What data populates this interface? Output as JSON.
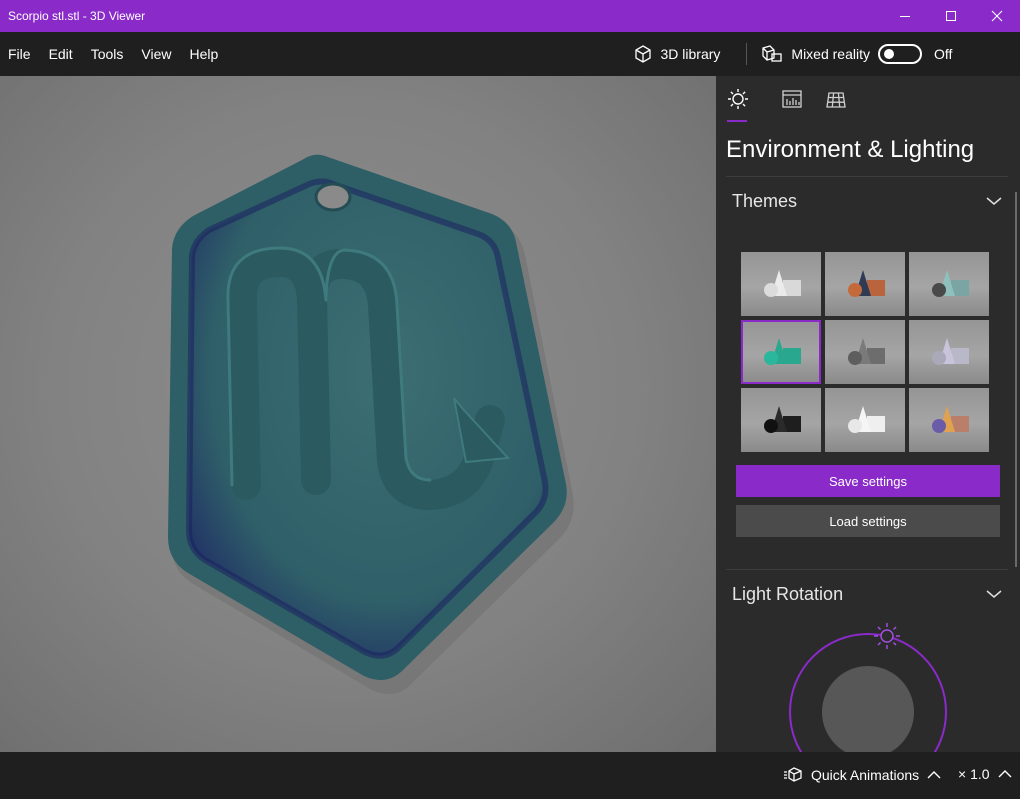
{
  "window": {
    "title": "Scorpio stl.stl - 3D Viewer",
    "accent": "#8a2bc9"
  },
  "menu": {
    "items": [
      {
        "label": "File"
      },
      {
        "label": "Edit"
      },
      {
        "label": "Tools"
      },
      {
        "label": "View"
      },
      {
        "label": "Help"
      }
    ]
  },
  "toolbar": {
    "library_label": "3D library",
    "library_icon": "cube-icon",
    "mixed_reality_label": "Mixed reality",
    "mixed_reality_icon": "mixed-reality-icon",
    "mixed_reality_state": "Off"
  },
  "viewport": {
    "model_color": "#2d5d66",
    "background": "#838383"
  },
  "panel": {
    "tabs": [
      {
        "icon": "environment-lighting-icon",
        "active": true
      },
      {
        "icon": "stats-shading-icon",
        "active": false
      },
      {
        "icon": "grid-icon",
        "active": false
      }
    ],
    "title": "Environment & Lighting",
    "themes": {
      "heading": "Themes",
      "selected_index": 3,
      "count": 9
    },
    "save_label": "Save settings",
    "load_label": "Load settings",
    "light_rotation": {
      "heading": "Light Rotation"
    }
  },
  "status": {
    "quick_animations_label": "Quick Animations",
    "speed_label": "× 1.0"
  }
}
